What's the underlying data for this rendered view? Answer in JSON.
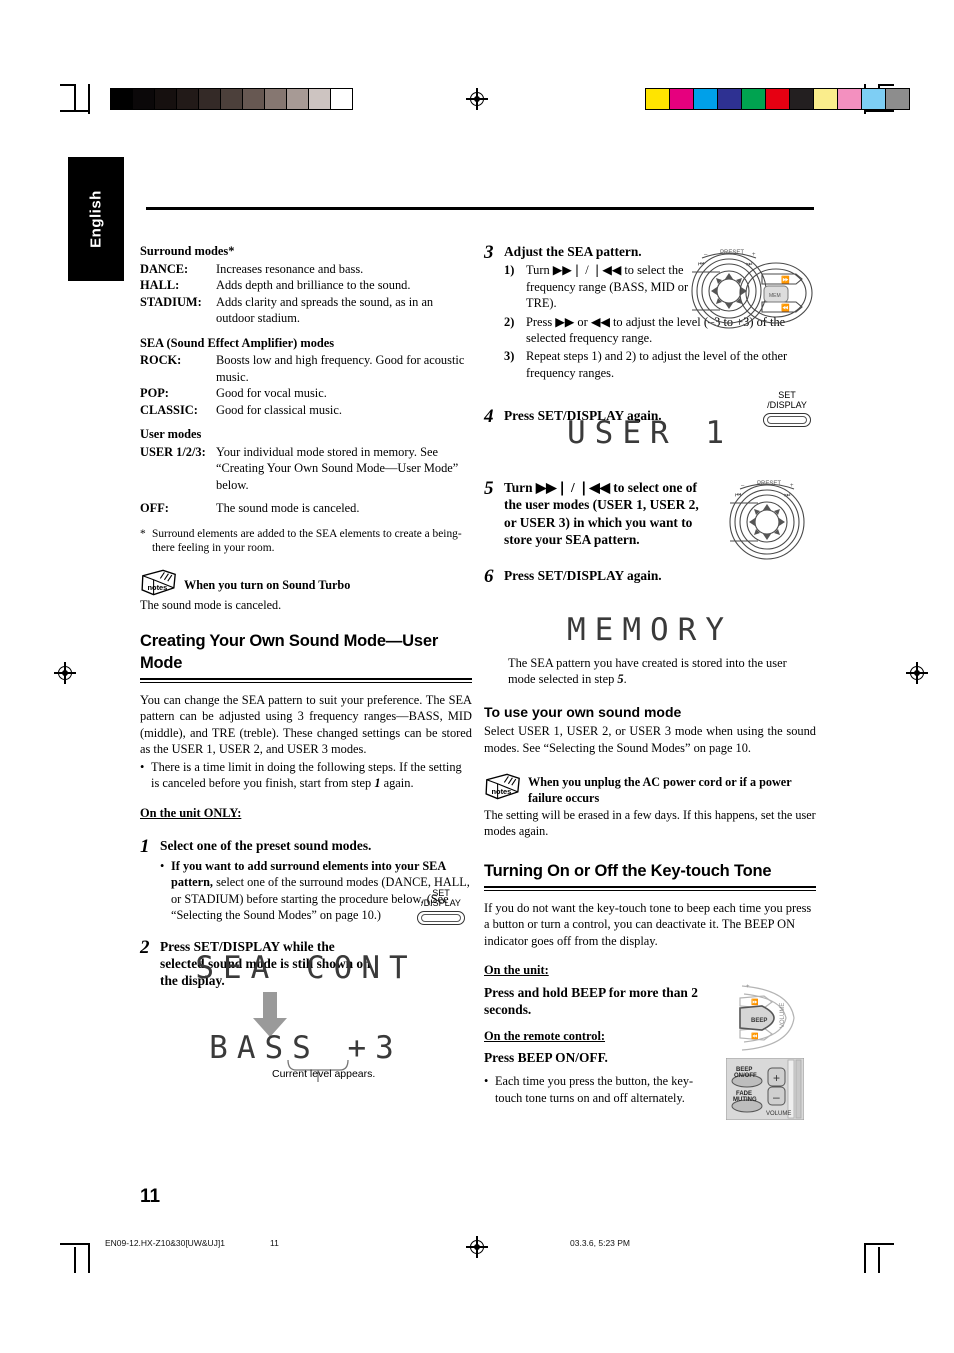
{
  "language_tab": "English",
  "page_number": "11",
  "footer": {
    "filename": "EN09-12.HX-Z10&30[UW&UJ]1",
    "page": "11",
    "timestamp": "03.3.6, 5:23 PM"
  },
  "color_bars": {
    "grayscale": [
      "#000000",
      "#0b0809",
      "#16100f",
      "#221a18",
      "#342a27",
      "#4c403b",
      "#675852",
      "#867771",
      "#a79a95",
      "#cdc4c1",
      "#ffffff"
    ],
    "colors": [
      "#ffe400",
      "#e6007e",
      "#00a0e9",
      "#2e3192",
      "#00a350",
      "#e60012",
      "#231f20",
      "#faed8c",
      "#f390bf",
      "#7ecef4",
      "#8d8d8d"
    ]
  },
  "left_column": {
    "surround": {
      "heading": "Surround modes*",
      "items": [
        {
          "term": "DANCE:",
          "desc": "Increases resonance and bass."
        },
        {
          "term": "HALL:",
          "desc": "Adds depth and brilliance to the sound."
        },
        {
          "term": "STADIUM:",
          "desc": "Adds clarity and spreads the sound, as in an outdoor stadium."
        }
      ]
    },
    "sea": {
      "heading": "SEA (Sound Effect Amplifier) modes",
      "items": [
        {
          "term": "ROCK:",
          "desc": "Boosts low and high frequency. Good for acoustic music."
        },
        {
          "term": "POP:",
          "desc": "Good for vocal music."
        },
        {
          "term": "CLASSIC:",
          "desc": "Good for classical music."
        }
      ]
    },
    "user": {
      "heading": "User modes",
      "items": [
        {
          "term": "USER 1/2/3:",
          "desc": "Your individual mode stored in memory. See “Creating Your Own Sound Mode—User Mode” below."
        },
        {
          "term": "OFF:",
          "desc": "The sound mode is canceled."
        }
      ]
    },
    "footnote": {
      "mark": "*",
      "text": "Surround elements are added to the SEA elements to create a being-there feeling in your room."
    },
    "note": {
      "icon": "notes-icon",
      "icon_label": "notes",
      "title": "When you turn on Sound Turbo",
      "body": "The sound mode is canceled."
    },
    "section": {
      "title": "Creating Your Own Sound Mode—User Mode",
      "intro": "You can change the SEA pattern to suit your preference. The SEA pattern can be adjusted using 3 frequency ranges—BASS, MID (middle), and TRE (treble). These changed settings can be stored as the USER 1, USER 2, and USER 3 modes.",
      "bullet_pre": "There is a time limit in doing the following steps. If the setting is canceled before you finish, start from step ",
      "bullet_step": "1",
      "bullet_post": " again.",
      "on_unit_only": "On the unit ONLY:"
    },
    "step1": {
      "num": "1",
      "title": "Select one of the preset sound modes.",
      "bullet_bold": "If you want to add surround elements into your SEA pattern,",
      "bullet_rest": " select one of the surround modes (DANCE, HALL, or STADIUM) before starting the procedure below. (See “Selecting the Sound Modes” on page 10.)"
    },
    "step2": {
      "num": "2",
      "title": "Press SET/DISPLAY while the selected sound mode is still shown on the display.",
      "button_line1": "SET",
      "button_line2": "/DISPLAY"
    },
    "display1": "SEA CONT",
    "display2": "BASS +3",
    "display_caption": "Current level appears."
  },
  "right_column": {
    "step3": {
      "num": "3",
      "title": "Adjust the SEA pattern.",
      "substeps": [
        {
          "label": "1)",
          "text": "Turn ▶▶❘ / ❘◀◀ to select the frequency range (BASS, MID or TRE)."
        },
        {
          "label": "2)",
          "text": "Press ▶▶ or ◀◀ to adjust the level (–3 to +3) of the selected frequency range."
        },
        {
          "label": "3)",
          "text": "Repeat steps 1) and 2) to adjust the level of the other frequency ranges."
        }
      ],
      "figure": "jog-dial-with-skip-buttons",
      "figure_labels": {
        "minus": "–",
        "plus": "+",
        "preset": "PRESET",
        "memory": "MEMORY"
      }
    },
    "step4": {
      "num": "4",
      "title": "Press SET/DISPLAY again.",
      "display": "USER 1",
      "button_line1": "SET",
      "button_line2": "/DISPLAY"
    },
    "step5": {
      "num": "5",
      "title": "Turn ▶▶❘ / ❘◀◀ to select one of the user modes (USER 1, USER 2, or USER 3) in which you want to store your SEA pattern.",
      "figure": "jog-dial",
      "figure_labels": {
        "minus": "–",
        "plus": "+",
        "preset": "PRESET"
      }
    },
    "step6": {
      "num": "6",
      "title": "Press SET/DISPLAY again.",
      "display": "MEMORY",
      "after_pre": "The SEA pattern you have created is stored into the user mode selected in step ",
      "after_step": "5",
      "after_post": "."
    },
    "use_own": {
      "title": "To use your own sound mode",
      "body": "Select USER 1, USER 2, or USER 3 mode when using the sound modes. See “Selecting the Sound Modes” on page 10."
    },
    "note": {
      "icon": "notes-icon",
      "icon_label": "notes",
      "title": "When you unplug the AC power cord or if a power failure occurs",
      "body": "The setting will be erased in a few days. If this happens, set the user modes again."
    },
    "keytouch": {
      "title": "Turning On or Off the Key-touch Tone",
      "body": "If you do not want the key-touch tone to beep each time you press a button or turn a control, you can deactivate it. The BEEP ON indicator goes off from the display.",
      "on_unit_head": "On the unit:",
      "on_unit_action": "Press and hold BEEP for more than 2 seconds.",
      "on_remote_head": "On the remote control:",
      "on_remote_action": "Press BEEP ON/OFF.",
      "bullet": "Each time you press the button, the key-touch tone turns on and off alternately.",
      "unit_figure_label": "BEEP",
      "remote_figure_labels": {
        "beep": "BEEP ON/OFF",
        "fade": "FADE MUTING",
        "plus": "+",
        "minus": "–",
        "volume": "VOLUME"
      }
    }
  }
}
